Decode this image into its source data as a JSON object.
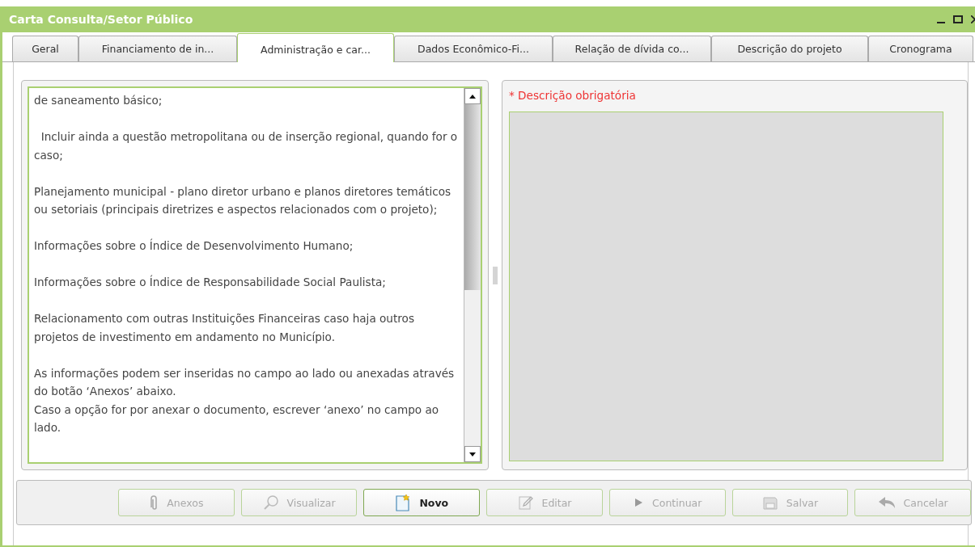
{
  "window": {
    "title": "Carta Consulta/Setor Público"
  },
  "tabs": [
    {
      "label": "Geral",
      "selected": false
    },
    {
      "label": "Financiamento de in...",
      "selected": false
    },
    {
      "label": "Administração e car...",
      "selected": true
    },
    {
      "label": "Dados Econômico-Fi...",
      "selected": false
    },
    {
      "label": "Relação de dívida co...",
      "selected": false
    },
    {
      "label": "Descrição do projeto",
      "selected": false
    },
    {
      "label": "Cronograma",
      "selected": false
    }
  ],
  "instructions": {
    "blocks": [
      [
        "de saneamento básico;"
      ],
      [
        "  Incluir ainda a questão metropolitana ou de inserção regional, quando for o caso;"
      ],
      [
        "Planejamento municipal - plano diretor urbano e planos diretores temáticos ou setoriais (principais diretrizes e aspectos relacionados com o projeto);"
      ],
      [
        "Informações sobre o Índice de Desenvolvimento Humano;"
      ],
      [
        "Informações sobre o Índice de Responsabilidade Social Paulista;"
      ],
      [
        "Relacionamento com outras Instituições Financeiras caso haja outros projetos de investimento em andamento no Município."
      ],
      [
        "As informações podem ser inseridas no campo ao lado ou anexadas através do botão ‘Anexos’ abaixo.",
        "Caso a opção for por anexar o documento, escrever ‘anexo’ no campo ao lado."
      ]
    ]
  },
  "description": {
    "label": "* Descrição obrigatória",
    "disabled": true
  },
  "buttons": [
    {
      "label": "Anexos",
      "kind": "attach",
      "disabled": true
    },
    {
      "label": "Visualizar",
      "kind": "view",
      "disabled": true
    },
    {
      "label": "Novo",
      "kind": "new",
      "disabled": false
    },
    {
      "label": "Editar",
      "kind": "edit",
      "disabled": true
    },
    {
      "label": "Continuar",
      "kind": "continue",
      "disabled": true
    },
    {
      "label": "Salvar",
      "kind": "save",
      "disabled": true
    },
    {
      "label": "Cancelar",
      "kind": "cancel",
      "disabled": true
    }
  ]
}
